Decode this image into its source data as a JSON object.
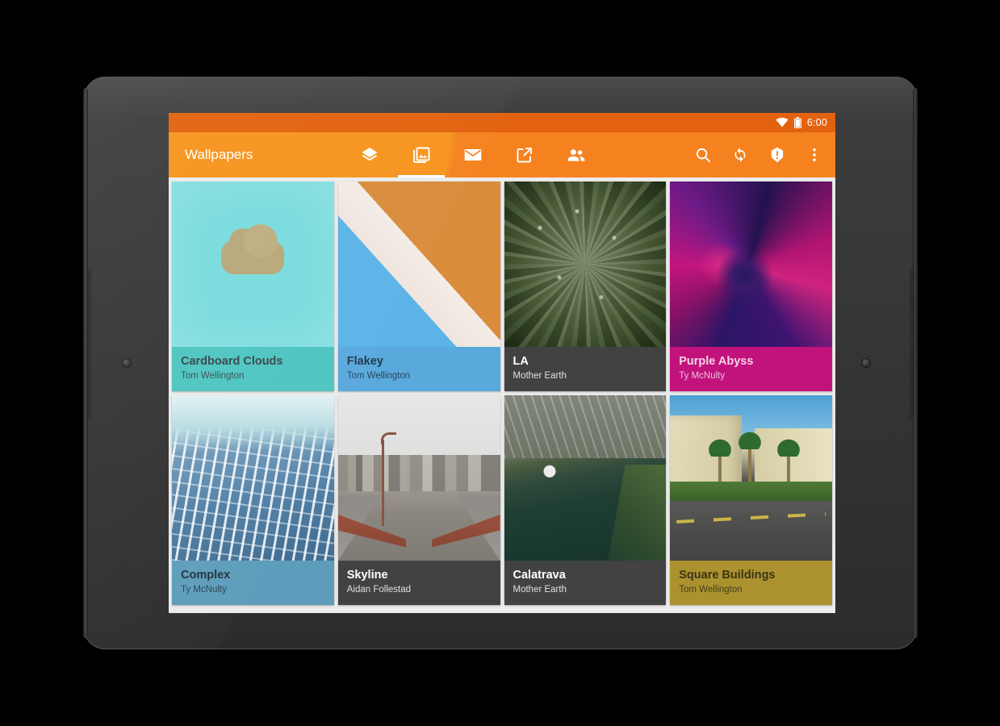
{
  "status_bar": {
    "clock": "6:00",
    "wifi_icon": "wifi-icon",
    "battery_icon": "battery-icon"
  },
  "app_bar": {
    "title": "Wallpapers",
    "accent_color": "#f5821f",
    "tabs": [
      {
        "name": "tab-layers",
        "icon": "layers-icon",
        "selected": false
      },
      {
        "name": "tab-photos",
        "icon": "photo-library-icon",
        "selected": true
      },
      {
        "name": "tab-email",
        "icon": "email-icon",
        "selected": false
      },
      {
        "name": "tab-open",
        "icon": "open-in-new-icon",
        "selected": false
      },
      {
        "name": "tab-people",
        "icon": "people-icon",
        "selected": false
      }
    ],
    "actions": [
      {
        "name": "search-button",
        "icon": "search-icon"
      },
      {
        "name": "sync-button",
        "icon": "sync-icon"
      },
      {
        "name": "alert-button",
        "icon": "error-badge-icon"
      },
      {
        "name": "overflow-button",
        "icon": "more-vert-icon"
      }
    ]
  },
  "grid": {
    "cards": [
      {
        "title": "Cardboard Clouds",
        "author": "Tom Wellington",
        "caption_bg": "#4ec5c1",
        "title_color": "#39474a",
        "author_color": "#3e5154",
        "art": "art-clouds"
      },
      {
        "title": "Flakey",
        "author": "Tom Wellington",
        "caption_bg": "#5aa9dd",
        "title_color": "#213a4d",
        "author_color": "#27465c",
        "art": "art-flakey"
      },
      {
        "title": "LA",
        "author": "Mother Earth",
        "caption_bg": "#424242",
        "title_color": "#ffffff",
        "author_color": "#e0e0e0",
        "art": "art-la"
      },
      {
        "title": "Purple Abyss",
        "author": "Ty McNulty",
        "caption_bg": "#c2127c",
        "title_color": "#f4d3e6",
        "author_color": "#ecc2dc",
        "art": "art-purple"
      },
      {
        "title": "Complex",
        "author": "Ty McNulty",
        "caption_bg": "#5d9dbb",
        "title_color": "#21333c",
        "author_color": "#2a4451",
        "art": "art-complex"
      },
      {
        "title": "Skyline",
        "author": "Aidan Follestad",
        "caption_bg": "#424242",
        "title_color": "#ffffff",
        "author_color": "#e0e0e0",
        "art": "art-skyline"
      },
      {
        "title": "Calatrava",
        "author": "Mother Earth",
        "caption_bg": "#424242",
        "title_color": "#ffffff",
        "author_color": "#e0e0e0",
        "art": "art-calatrava"
      },
      {
        "title": "Square Buildings",
        "author": "Tom Wellington",
        "caption_bg": "#ab922f",
        "title_color": "#3b3415",
        "author_color": "#453d1b",
        "art": "art-square"
      }
    ]
  },
  "nav_bar": {
    "buttons": [
      {
        "name": "nav-back-button",
        "icon": "back-triangle-icon"
      },
      {
        "name": "nav-home-button",
        "icon": "home-circle-icon"
      },
      {
        "name": "nav-recents-button",
        "icon": "recents-square-icon"
      }
    ]
  }
}
